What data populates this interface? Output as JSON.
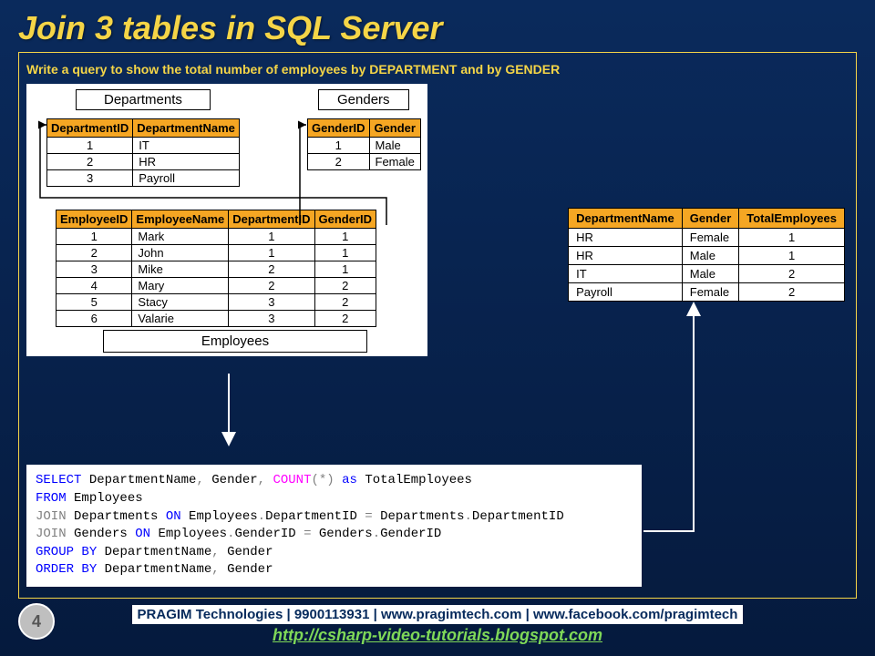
{
  "title": "Join 3 tables in SQL Server",
  "subtitle": "Write a query to show the total number of employees by DEPARTMENT and by GENDER",
  "tables": {
    "departments": {
      "label": "Departments",
      "headers": [
        "DepartmentID",
        "DepartmentName"
      ],
      "rows": [
        [
          "1",
          "IT"
        ],
        [
          "2",
          "HR"
        ],
        [
          "3",
          "Payroll"
        ]
      ]
    },
    "genders": {
      "label": "Genders",
      "headers": [
        "GenderID",
        "Gender"
      ],
      "rows": [
        [
          "1",
          "Male"
        ],
        [
          "2",
          "Female"
        ]
      ]
    },
    "employees": {
      "label": "Employees",
      "headers": [
        "EmployeeID",
        "EmployeeName",
        "DepartmentID",
        "GenderID"
      ],
      "rows": [
        [
          "1",
          "Mark",
          "1",
          "1"
        ],
        [
          "2",
          "John",
          "1",
          "1"
        ],
        [
          "3",
          "Mike",
          "2",
          "1"
        ],
        [
          "4",
          "Mary",
          "2",
          "2"
        ],
        [
          "5",
          "Stacy",
          "3",
          "2"
        ],
        [
          "6",
          "Valarie",
          "3",
          "2"
        ]
      ]
    },
    "result": {
      "headers": [
        "DepartmentName",
        "Gender",
        "TotalEmployees"
      ],
      "rows": [
        [
          "HR",
          "Female",
          "1"
        ],
        [
          "HR",
          "Male",
          "1"
        ],
        [
          "IT",
          "Male",
          "2"
        ],
        [
          "Payroll",
          "Female",
          "2"
        ]
      ]
    }
  },
  "query": {
    "l1a": "SELECT",
    "l1b": " DepartmentName",
    "l1c": ",",
    "l1d": " Gender",
    "l1e": ",",
    "l1f": " COUNT",
    "l1g": "(*)",
    "l1h": " as",
    "l1i": " TotalEmployees",
    "l2a": "FROM",
    "l2b": " Employees",
    "l3a": "JOIN",
    "l3b": " Departments ",
    "l3c": "ON",
    "l3d": " Employees",
    "l3e": ".",
    "l3f": "DepartmentID ",
    "l3g": "=",
    "l3h": " Departments",
    "l3i": ".",
    "l3j": "DepartmentID",
    "l4a": "JOIN",
    "l4b": " Genders ",
    "l4c": "ON",
    "l4d": " Employees",
    "l4e": ".",
    "l4f": "GenderID ",
    "l4g": "=",
    "l4h": " Genders",
    "l4i": ".",
    "l4j": "GenderID",
    "l5a": "GROUP",
    "l5b": " BY",
    "l5c": " DepartmentName",
    "l5d": ",",
    "l5e": " Gender",
    "l6a": "ORDER",
    "l6b": " BY",
    "l6c": " DepartmentName",
    "l6d": ",",
    "l6e": " Gender"
  },
  "footer": {
    "bar": "PRAGIM Technologies | 9900113931 | www.pragimtech.com | www.facebook.com/pragimtech",
    "link": "http://csharp-video-tutorials.blogspot.com"
  },
  "page": "4"
}
